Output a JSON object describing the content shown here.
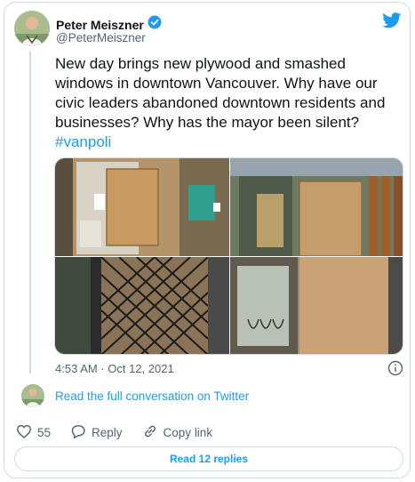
{
  "author": {
    "name": "Peter Meiszner",
    "handle": "@PeterMeiszner",
    "verified": true
  },
  "tweet": {
    "text": "New day brings new plywood and smashed windows in downtown Vancouver. Why have our civic leaders abandoned downtown residents and businesses? Why has the mayor been silent?",
    "hashtag": "#vanpoli",
    "timestamp": "4:53 AM · Oct 12, 2021",
    "photos": [
      {
        "subject": "boarded glass door with posted notice"
      },
      {
        "subject": "plywood covering storefront window"
      },
      {
        "subject": "metal security gate over window"
      },
      {
        "subject": "plywood over shop entrance"
      }
    ]
  },
  "conversation": {
    "link_label": "Read the full conversation on Twitter"
  },
  "actions": {
    "like_count": "55",
    "reply_label": "Reply",
    "copy_label": "Copy link"
  },
  "footer": {
    "read_replies_label": "Read 12 replies"
  },
  "colors": {
    "accent": "#1d9bf0",
    "secondary_text": "#536471",
    "border": "#cfd9de"
  },
  "icons": [
    "twitter-bird-icon",
    "verified-badge-icon",
    "info-icon",
    "heart-icon",
    "reply-icon",
    "link-icon"
  ]
}
